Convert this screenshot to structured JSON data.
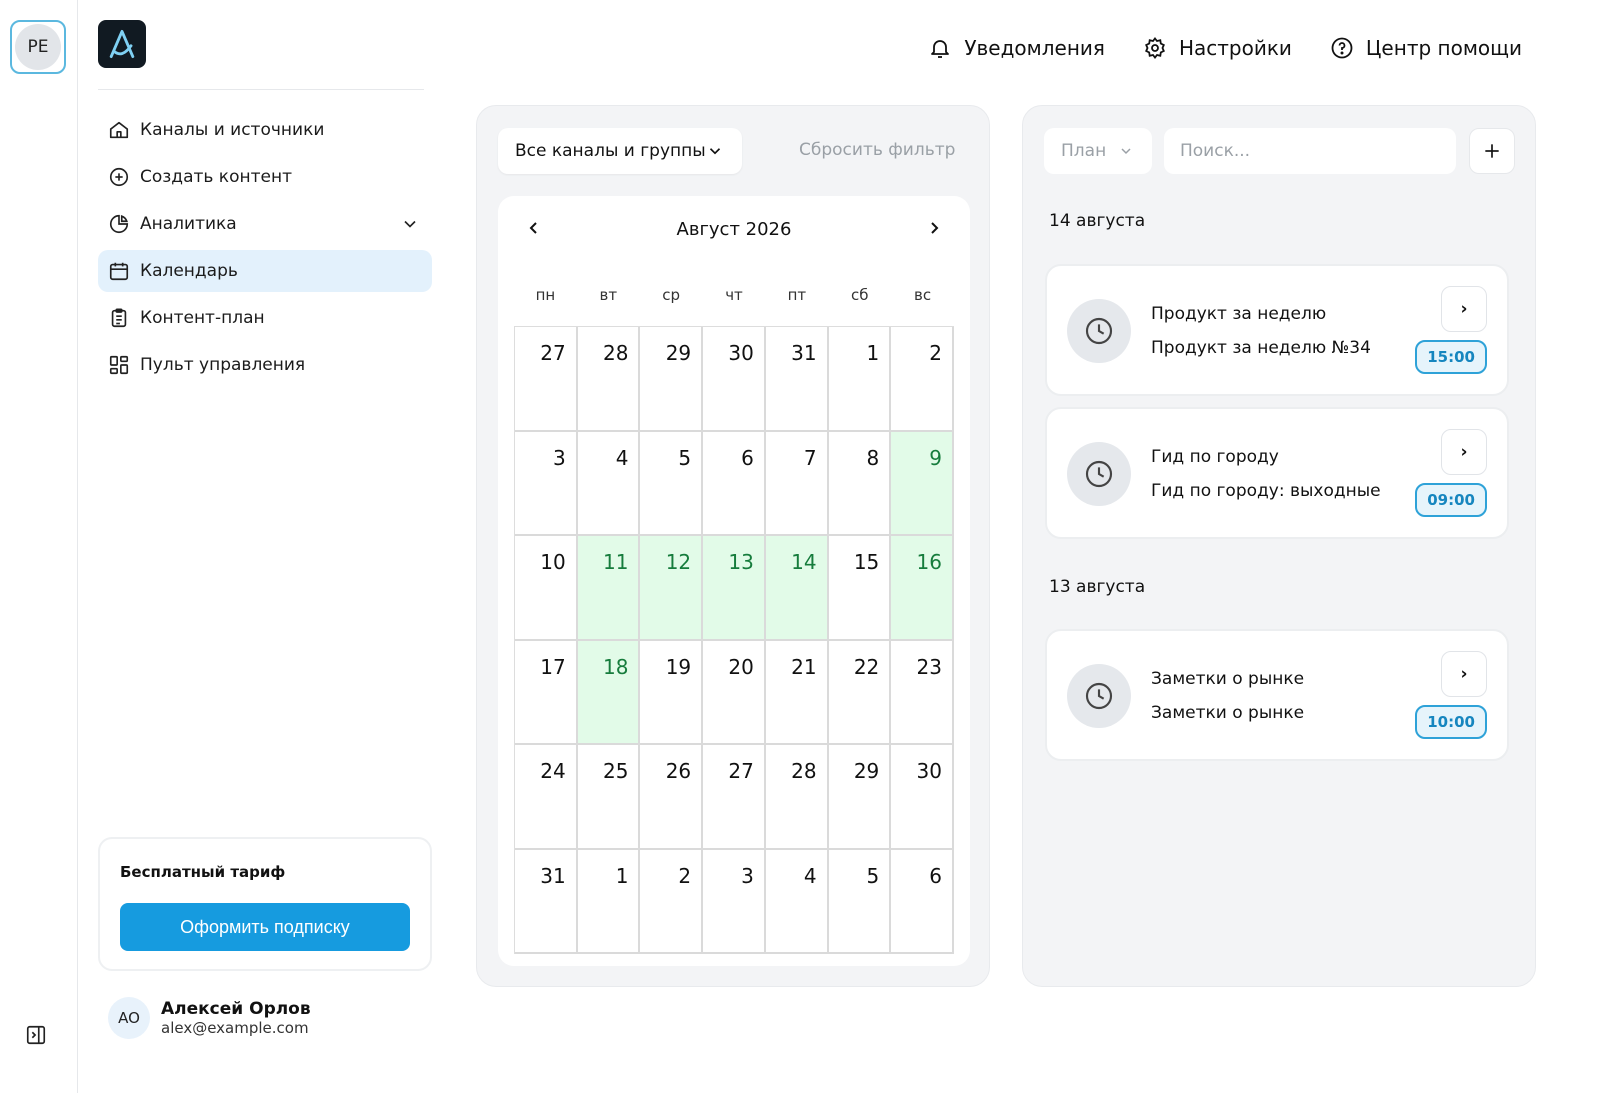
{
  "workspace": {
    "initials": "PE"
  },
  "sidebar": {
    "items": [
      {
        "label": "Каналы и источники",
        "icon": "home-icon"
      },
      {
        "label": "Создать контент",
        "icon": "plus-circle-icon"
      },
      {
        "label": "Аналитика",
        "icon": "pie-chart-icon",
        "expandable": true
      },
      {
        "label": "Календарь",
        "icon": "calendar-icon",
        "active": true
      },
      {
        "label": "Контент-план",
        "icon": "clipboard-list-icon"
      },
      {
        "label": "Пульт управления",
        "icon": "dashboard-grid-icon"
      }
    ],
    "plan": {
      "title": "Бесплатный тариф",
      "button_label": "Оформить подписку"
    },
    "user": {
      "initials": "AO",
      "name": "Алексей Орлов",
      "email": "alex@example.com"
    }
  },
  "topbar": {
    "notifications_label": "Уведомления",
    "settings_label": "Настройки",
    "help_label": "Центр помощи"
  },
  "calendar": {
    "filter_label": "Все каналы и группы",
    "reset_label": "Сбросить фильтр",
    "month_label": "Август 2026",
    "weekdays": [
      "пн",
      "вт",
      "ср",
      "чт",
      "пт",
      "сб",
      "вс"
    ],
    "days": [
      27,
      28,
      29,
      30,
      31,
      1,
      2,
      3,
      4,
      5,
      6,
      7,
      8,
      9,
      10,
      11,
      12,
      13,
      14,
      15,
      16,
      17,
      18,
      19,
      20,
      21,
      22,
      23,
      24,
      25,
      26,
      27,
      28,
      29,
      30,
      31,
      1,
      2,
      3,
      4,
      5,
      6
    ],
    "highlighted_indices": [
      13,
      15,
      16,
      17,
      18,
      20,
      22
    ]
  },
  "schedule": {
    "plan_filter_label": "План",
    "search_placeholder": "Поиск...",
    "groups": [
      {
        "date": "14 августа",
        "events": [
          {
            "title": "Продукт за неделю",
            "subtitle": "Продукт за неделю №34",
            "time": "15:00"
          },
          {
            "title": "Гид по городу",
            "subtitle": "Гид по городу: выходные",
            "time": "09:00"
          }
        ]
      },
      {
        "date": "13 августа",
        "events": [
          {
            "title": "Заметки о рынке",
            "subtitle": "Заметки о рынке",
            "time": "10:00"
          }
        ]
      }
    ]
  },
  "colors": {
    "accent": "#169bdf",
    "highlight_bg": "#e2fbe8",
    "highlight_text": "#167c3c",
    "active_nav": "#e3f1fc"
  }
}
